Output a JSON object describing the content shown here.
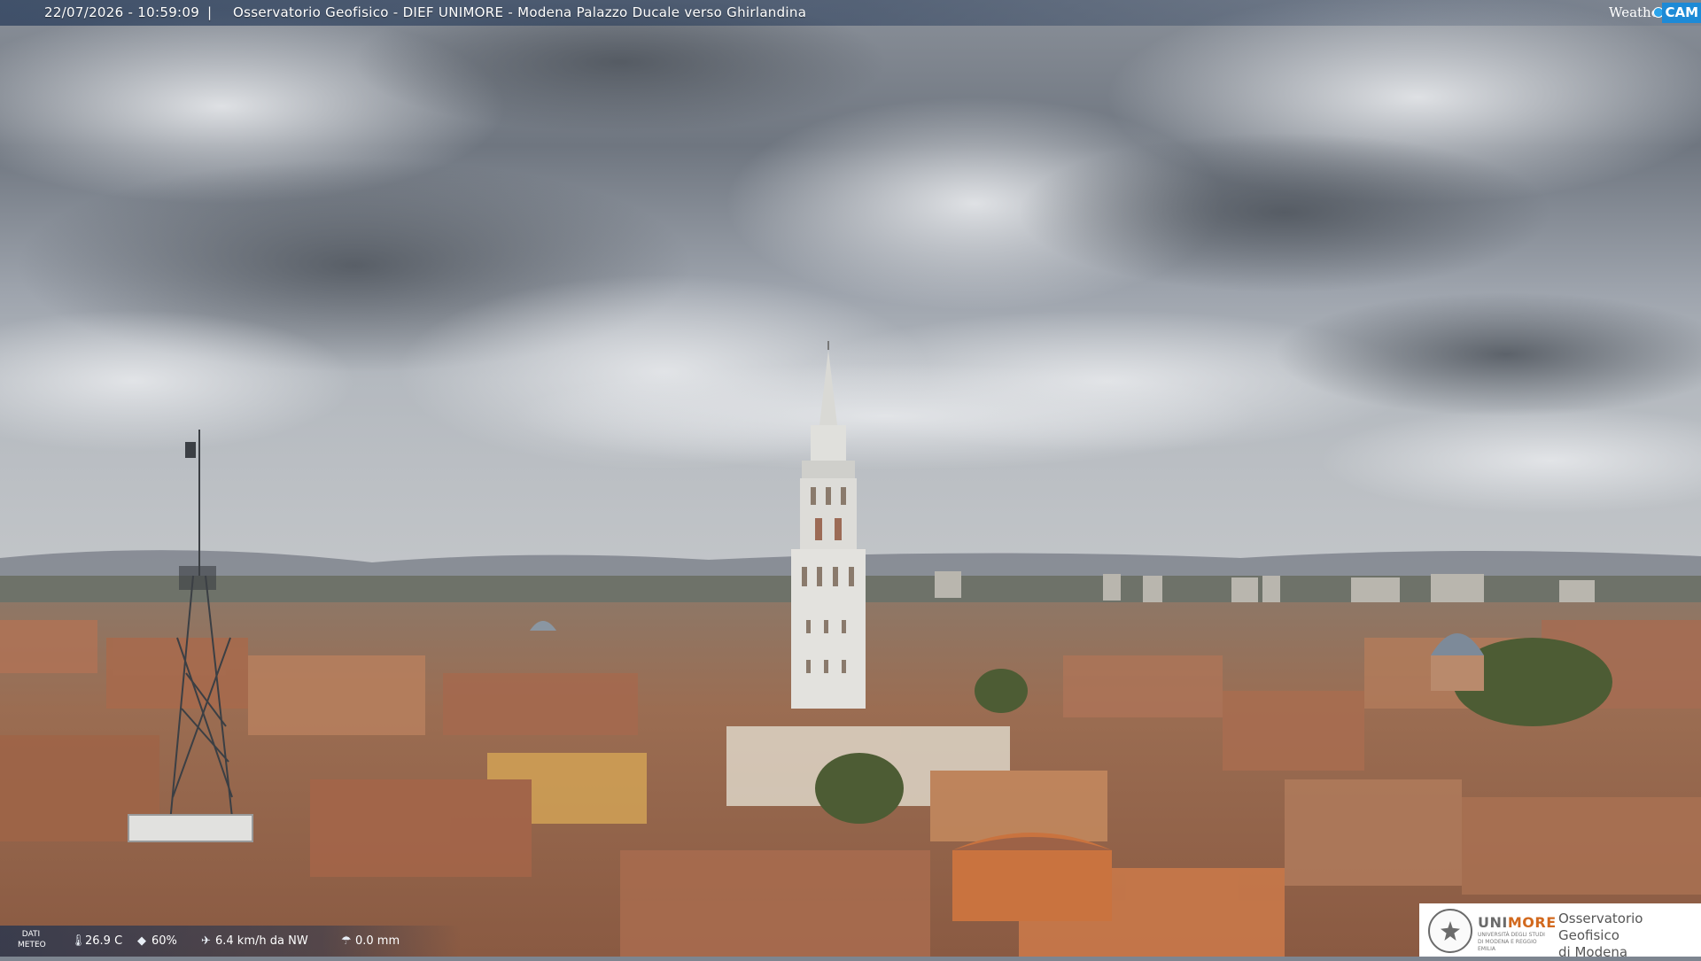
{
  "overlay": {
    "datetime": "22/07/2026 - 10:59:09",
    "separator": "|",
    "title": "Osservatorio Geofisico - DIEF UNIMORE - Modena Palazzo Ducale verso Ghirlandina",
    "logo_word": "Weather",
    "logo_cam": "CAM"
  },
  "meteo": {
    "label": "DATI METEO",
    "temperature": "26.9 C",
    "humidity": "60%",
    "wind": "6.4 km/h da NW",
    "rain": "0.0 mm",
    "icons": [
      "thermometer-icon",
      "humidity-drop-icon",
      "wind-sock-icon",
      "rain-gauge-icon"
    ]
  },
  "branding": {
    "university_a": "UNI",
    "university_b": "MORE",
    "university_sub": "UNIVERSITÀ DEGLI STUDI DI MODENA E REGGIO EMILIA",
    "observatory_line1": "Osservatorio Geofisico",
    "observatory_line2": "di Modena"
  },
  "colors": {
    "sky_light": "#c9ccd1",
    "sky_dark": "#5c626b",
    "roof": "#9a6a50",
    "tower": "#dcdcd8",
    "accent_orange": "#d2691e",
    "logo_blue": "#1d8ad6"
  }
}
